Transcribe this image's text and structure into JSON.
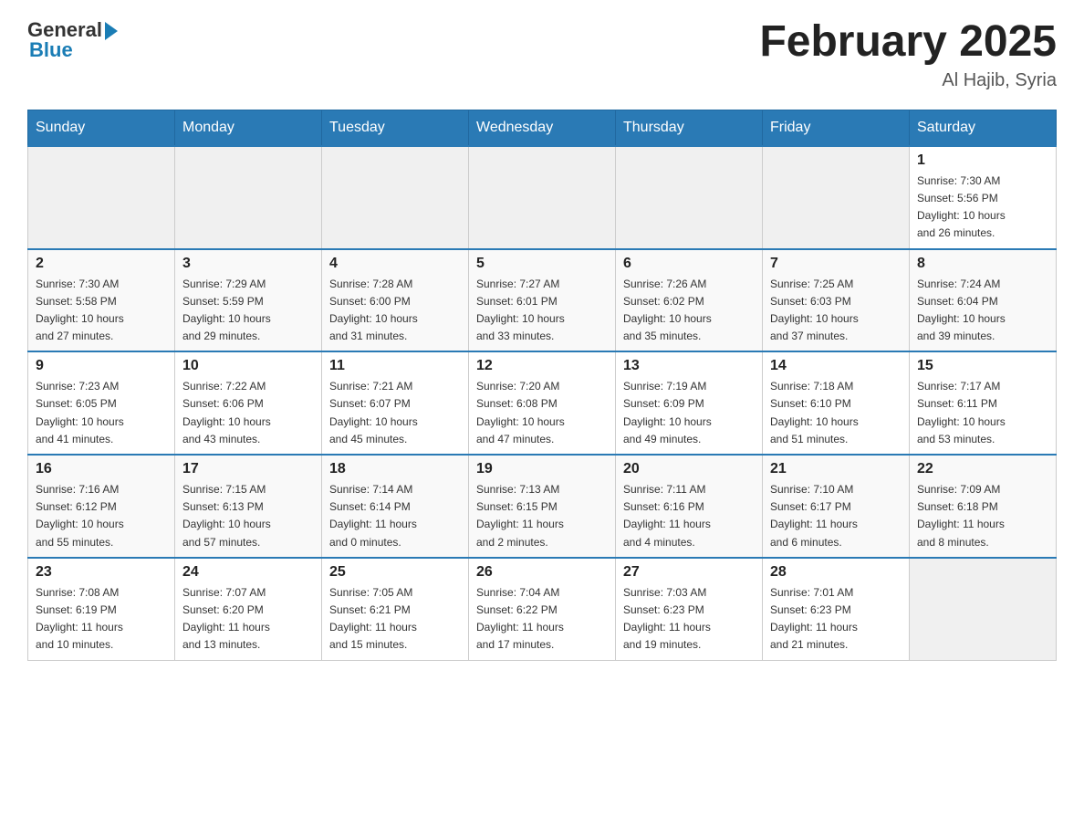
{
  "header": {
    "logo_general": "General",
    "logo_blue": "Blue",
    "month_title": "February 2025",
    "location": "Al Hajib, Syria"
  },
  "weekdays": [
    "Sunday",
    "Monday",
    "Tuesday",
    "Wednesday",
    "Thursday",
    "Friday",
    "Saturday"
  ],
  "weeks": [
    [
      {
        "day": "",
        "info": ""
      },
      {
        "day": "",
        "info": ""
      },
      {
        "day": "",
        "info": ""
      },
      {
        "day": "",
        "info": ""
      },
      {
        "day": "",
        "info": ""
      },
      {
        "day": "",
        "info": ""
      },
      {
        "day": "1",
        "info": "Sunrise: 7:30 AM\nSunset: 5:56 PM\nDaylight: 10 hours\nand 26 minutes."
      }
    ],
    [
      {
        "day": "2",
        "info": "Sunrise: 7:30 AM\nSunset: 5:58 PM\nDaylight: 10 hours\nand 27 minutes."
      },
      {
        "day": "3",
        "info": "Sunrise: 7:29 AM\nSunset: 5:59 PM\nDaylight: 10 hours\nand 29 minutes."
      },
      {
        "day": "4",
        "info": "Sunrise: 7:28 AM\nSunset: 6:00 PM\nDaylight: 10 hours\nand 31 minutes."
      },
      {
        "day": "5",
        "info": "Sunrise: 7:27 AM\nSunset: 6:01 PM\nDaylight: 10 hours\nand 33 minutes."
      },
      {
        "day": "6",
        "info": "Sunrise: 7:26 AM\nSunset: 6:02 PM\nDaylight: 10 hours\nand 35 minutes."
      },
      {
        "day": "7",
        "info": "Sunrise: 7:25 AM\nSunset: 6:03 PM\nDaylight: 10 hours\nand 37 minutes."
      },
      {
        "day": "8",
        "info": "Sunrise: 7:24 AM\nSunset: 6:04 PM\nDaylight: 10 hours\nand 39 minutes."
      }
    ],
    [
      {
        "day": "9",
        "info": "Sunrise: 7:23 AM\nSunset: 6:05 PM\nDaylight: 10 hours\nand 41 minutes."
      },
      {
        "day": "10",
        "info": "Sunrise: 7:22 AM\nSunset: 6:06 PM\nDaylight: 10 hours\nand 43 minutes."
      },
      {
        "day": "11",
        "info": "Sunrise: 7:21 AM\nSunset: 6:07 PM\nDaylight: 10 hours\nand 45 minutes."
      },
      {
        "day": "12",
        "info": "Sunrise: 7:20 AM\nSunset: 6:08 PM\nDaylight: 10 hours\nand 47 minutes."
      },
      {
        "day": "13",
        "info": "Sunrise: 7:19 AM\nSunset: 6:09 PM\nDaylight: 10 hours\nand 49 minutes."
      },
      {
        "day": "14",
        "info": "Sunrise: 7:18 AM\nSunset: 6:10 PM\nDaylight: 10 hours\nand 51 minutes."
      },
      {
        "day": "15",
        "info": "Sunrise: 7:17 AM\nSunset: 6:11 PM\nDaylight: 10 hours\nand 53 minutes."
      }
    ],
    [
      {
        "day": "16",
        "info": "Sunrise: 7:16 AM\nSunset: 6:12 PM\nDaylight: 10 hours\nand 55 minutes."
      },
      {
        "day": "17",
        "info": "Sunrise: 7:15 AM\nSunset: 6:13 PM\nDaylight: 10 hours\nand 57 minutes."
      },
      {
        "day": "18",
        "info": "Sunrise: 7:14 AM\nSunset: 6:14 PM\nDaylight: 11 hours\nand 0 minutes."
      },
      {
        "day": "19",
        "info": "Sunrise: 7:13 AM\nSunset: 6:15 PM\nDaylight: 11 hours\nand 2 minutes."
      },
      {
        "day": "20",
        "info": "Sunrise: 7:11 AM\nSunset: 6:16 PM\nDaylight: 11 hours\nand 4 minutes."
      },
      {
        "day": "21",
        "info": "Sunrise: 7:10 AM\nSunset: 6:17 PM\nDaylight: 11 hours\nand 6 minutes."
      },
      {
        "day": "22",
        "info": "Sunrise: 7:09 AM\nSunset: 6:18 PM\nDaylight: 11 hours\nand 8 minutes."
      }
    ],
    [
      {
        "day": "23",
        "info": "Sunrise: 7:08 AM\nSunset: 6:19 PM\nDaylight: 11 hours\nand 10 minutes."
      },
      {
        "day": "24",
        "info": "Sunrise: 7:07 AM\nSunset: 6:20 PM\nDaylight: 11 hours\nand 13 minutes."
      },
      {
        "day": "25",
        "info": "Sunrise: 7:05 AM\nSunset: 6:21 PM\nDaylight: 11 hours\nand 15 minutes."
      },
      {
        "day": "26",
        "info": "Sunrise: 7:04 AM\nSunset: 6:22 PM\nDaylight: 11 hours\nand 17 minutes."
      },
      {
        "day": "27",
        "info": "Sunrise: 7:03 AM\nSunset: 6:23 PM\nDaylight: 11 hours\nand 19 minutes."
      },
      {
        "day": "28",
        "info": "Sunrise: 7:01 AM\nSunset: 6:23 PM\nDaylight: 11 hours\nand 21 minutes."
      },
      {
        "day": "",
        "info": ""
      }
    ]
  ]
}
